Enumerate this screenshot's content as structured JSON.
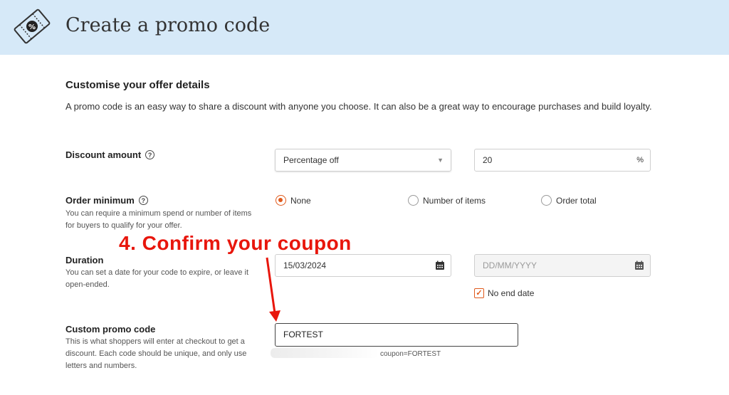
{
  "header": {
    "title": "Create a promo code",
    "icon": "ticket-percent-icon"
  },
  "offer": {
    "section_title": "Customise your offer details",
    "intro": "A promo code is an easy way to share a discount with anyone you choose. It can also be a great way to encourage purchases and build loyalty."
  },
  "discount": {
    "label": "Discount amount",
    "type_value": "Percentage off",
    "amount_value": "20",
    "suffix": "%"
  },
  "order_minimum": {
    "label": "Order minimum",
    "description": "You can require a minimum spend or number of items for buyers to qualify for your offer.",
    "options": [
      "None",
      "Number of items",
      "Order total"
    ],
    "selected": "None"
  },
  "duration": {
    "label": "Duration",
    "description": "You can set a date for your code to expire, or leave it open-ended.",
    "start_value": "15/03/2024",
    "end_placeholder": "DD/MM/YYYY",
    "no_end_label": "No end date",
    "no_end_checked": true
  },
  "custom_code": {
    "label": "Custom promo code",
    "description": "This is what shoppers will enter at checkout to get a discount. Each code should be unique, and only use letters and numbers.",
    "value": "FORTEST",
    "url_suffix": "coupon=FORTEST"
  },
  "annotation": {
    "text": "4. Confirm your coupon",
    "color": "#e8160c"
  },
  "colors": {
    "header_bg": "#d6e9f8",
    "accent": "#e05a1c"
  }
}
